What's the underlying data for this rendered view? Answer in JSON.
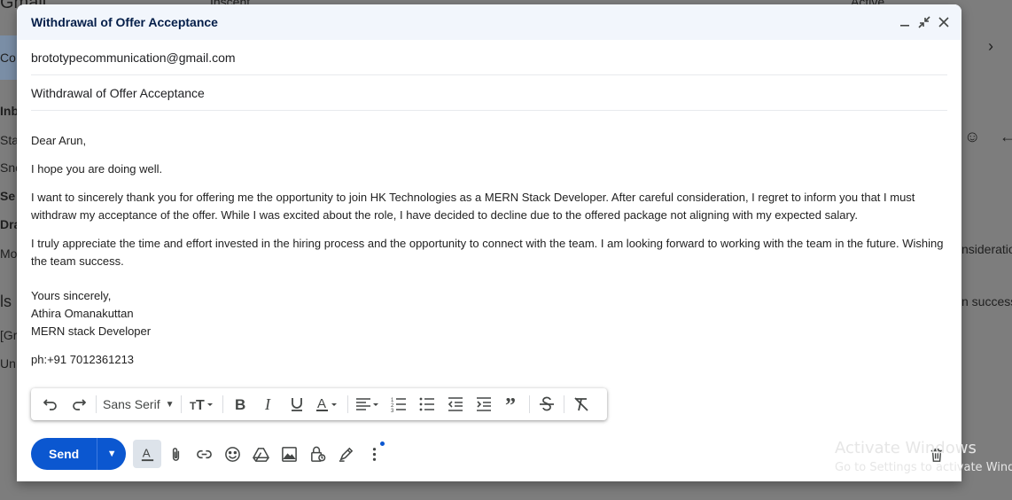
{
  "background": {
    "left_labels": [
      "Gmail",
      "Co",
      "Inb",
      "Sta",
      "Sno",
      "Se",
      "Dra",
      "Mo",
      "ls",
      "[Gr",
      "Un"
    ],
    "search_text": "Inscent",
    "status_text": "Active",
    "right_snippets": [
      "nsideration",
      "n success."
    ]
  },
  "compose": {
    "title": "Withdrawal of Offer Acceptance",
    "controls": {
      "minimize": "minimize",
      "expand": "expand",
      "close": "close"
    },
    "to": "brototypecommunication@gmail.com",
    "subject": "Withdrawal of Offer Acceptance",
    "body": {
      "greeting": "Dear Arun,",
      "p1": "I hope you are doing well.",
      "p2": "I want to sincerely thank you for offering me the opportunity to join HK Technologies as a MERN Stack Developer. After careful consideration, I regret to inform you that I must withdraw my acceptance of the offer. While I was excited about the role, I have decided to decline due to the offered package not aligning with my expected salary.",
      "p3": "I truly appreciate the time and effort invested in the hiring process and the opportunity to connect with the team.  I am looking forward to working with the team in the future. Wishing the team success.",
      "closing": "Yours sincerely,",
      "name": "Athira Omanakuttan",
      "role": "MERN stack Developer",
      "phone": "ph:+91 7012361213"
    }
  },
  "format_toolbar": {
    "font": "Sans Serif"
  },
  "bottom_toolbar": {
    "send_label": "Send"
  },
  "watermark": {
    "line1": "Activate Windows",
    "line2": "Go to Settings to activate Windows."
  },
  "colors": {
    "send_blue": "#0b57d0",
    "header_bg": "#f2f6fc",
    "overlay": "#7d7d7d"
  }
}
